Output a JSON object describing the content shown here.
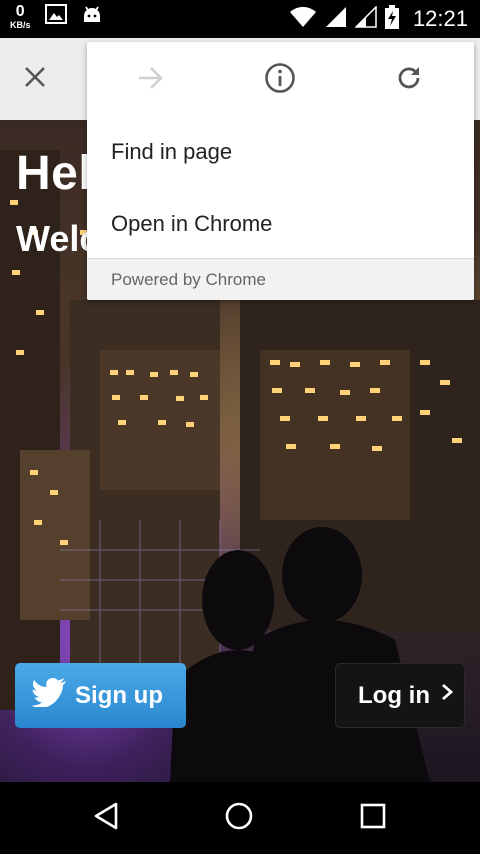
{
  "status_bar": {
    "net_speed_value": "0",
    "net_speed_unit": "KB/s",
    "time": "12:21",
    "icons": [
      "image-icon",
      "android-icon",
      "wifi-icon",
      "signal-icon",
      "signal-icon",
      "battery-charging-icon"
    ]
  },
  "toolbar": {
    "close_icon": "close-icon"
  },
  "page": {
    "title": "Hel",
    "subtitle": "Welc",
    "signup_label": "Sign up",
    "login_label": "Log in",
    "signup_icon": "twitter-bird-icon",
    "login_icon": "chevron-right-icon"
  },
  "menu": {
    "icons": [
      "forward-arrow-icon",
      "info-icon",
      "refresh-icon"
    ],
    "items": [
      {
        "label": "Find in page"
      },
      {
        "label": "Open in Chrome"
      }
    ],
    "footer": "Powered by Chrome"
  },
  "nav_bar": {
    "icons": [
      "back-icon",
      "home-icon",
      "recents-icon"
    ]
  },
  "colors": {
    "signup_blue": "#2a87cf",
    "toolbar_gray": "#ededed",
    "menu_footer": "#f2f2f2"
  }
}
